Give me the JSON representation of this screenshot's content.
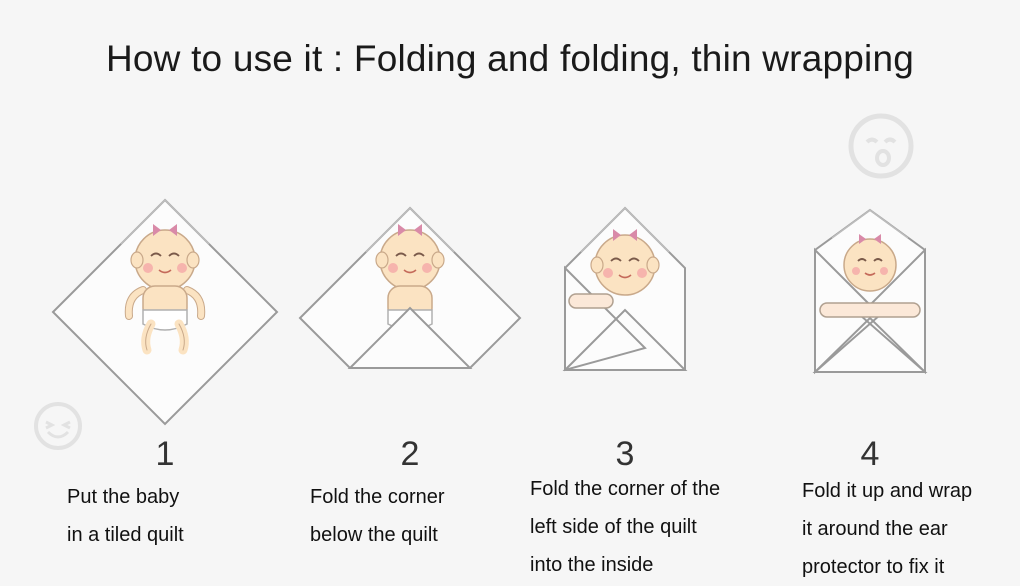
{
  "title": "How to use it : Folding and folding, thin wrapping",
  "steps": [
    {
      "number": "1",
      "lines": [
        "Put the baby",
        "in a tiled quilt"
      ]
    },
    {
      "number": "2",
      "lines": [
        "Fold the corner",
        "below the quilt"
      ]
    },
    {
      "number": "3",
      "lines": [
        "Fold the corner of the",
        "left side of the quilt",
        "into the inside"
      ]
    },
    {
      "number": "4",
      "lines": [
        "Fold it up and wrap",
        "it around the ear",
        "protector to fix it"
      ]
    }
  ],
  "colors": {
    "background": "#f6f6f6",
    "outline": "#9a9a9a",
    "skin": "#fbe3c2",
    "cheek": "#f5a8a8",
    "bow": "#d98aa8"
  }
}
